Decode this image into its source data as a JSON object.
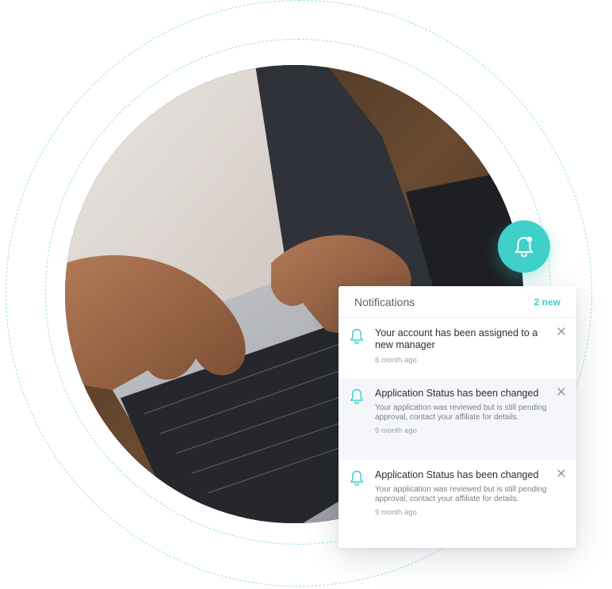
{
  "colors": {
    "accent": "#3fd1c9",
    "ring": "#7fdcd6",
    "panel_bg": "#ffffff",
    "row_alt_bg": "#f5f6fa"
  },
  "notifications_panel": {
    "title": "Notifications",
    "new_count": "2 new",
    "items": [
      {
        "icon": "bell-outline-icon",
        "title": "Your account has been assigned to a new manager",
        "body": "",
        "time": "6 month ago"
      },
      {
        "icon": "bell-outline-icon",
        "title": "Application Status has been changed",
        "body": "Your application was reviewed but is still pending approval, contact your affiliate for details.",
        "time": "9 month ago"
      },
      {
        "icon": "bell-outline-icon",
        "title": "Application Status has been changed",
        "body": "Your application was reviewed but is still pending approval, contact your affiliate for details.",
        "time": "9 month ago"
      }
    ]
  },
  "bell_badge": {
    "icon": "bell-with-dot-icon"
  },
  "photo": {
    "subject": "hands-typing-on-laptop"
  }
}
